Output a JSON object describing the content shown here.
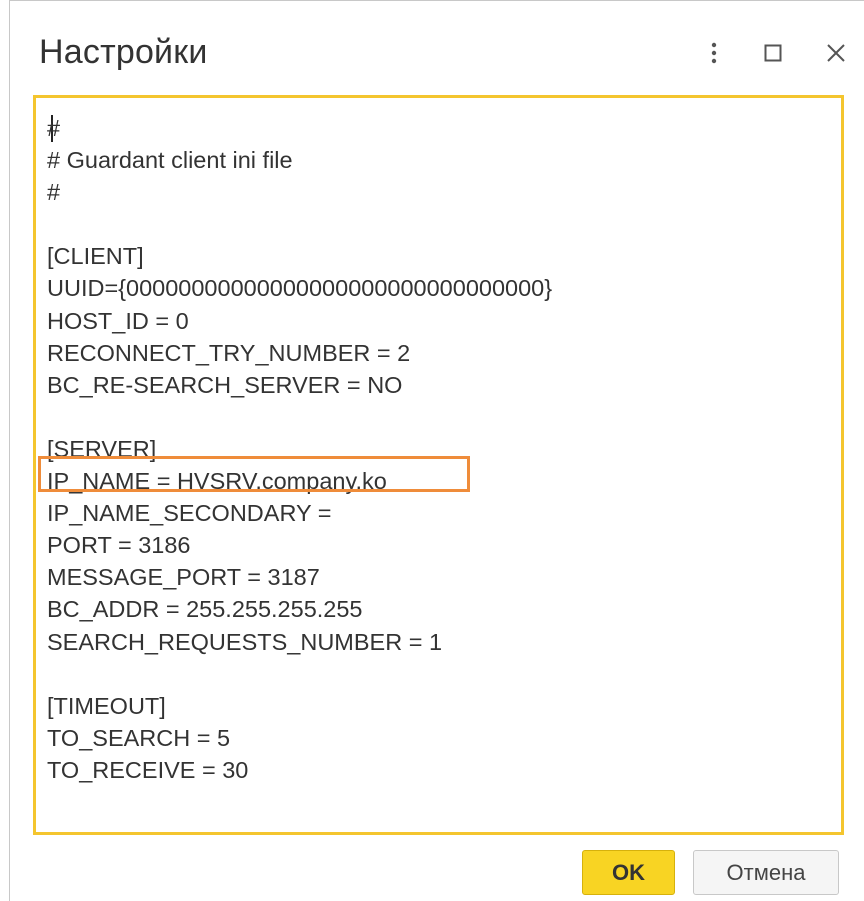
{
  "dialog": {
    "title": "Настройки"
  },
  "window_controls": {
    "more_icon": "vertical-ellipsis",
    "maximize_icon": "square",
    "close_icon": "x"
  },
  "editor": {
    "lines": [
      "#",
      "# Guardant client ini file",
      "#",
      "",
      "[CLIENT]",
      "UUID={00000000000000000000000000000000}",
      "HOST_ID = 0",
      "RECONNECT_TRY_NUMBER = 2",
      "BC_RE-SEARCH_SERVER = NO",
      "",
      "[SERVER]",
      "IP_NAME = HVSRV.company.ko",
      "IP_NAME_SECONDARY =",
      "PORT = 3186",
      "MESSAGE_PORT = 3187",
      "BC_ADDR = 255.255.255.255",
      "SEARCH_REQUESTS_NUMBER = 1",
      "",
      "[TIMEOUT]",
      "TO_SEARCH = 5",
      "TO_RECEIVE = 30"
    ],
    "highlighted_line": "IP_NAME = HVSRV.company.ko"
  },
  "footer": {
    "ok_label": "OK",
    "cancel_label": "Отмена"
  },
  "colors": {
    "editor_border": "#f4c52e",
    "highlight_border": "#ef8c3a",
    "ok_button": "#f8d423"
  }
}
